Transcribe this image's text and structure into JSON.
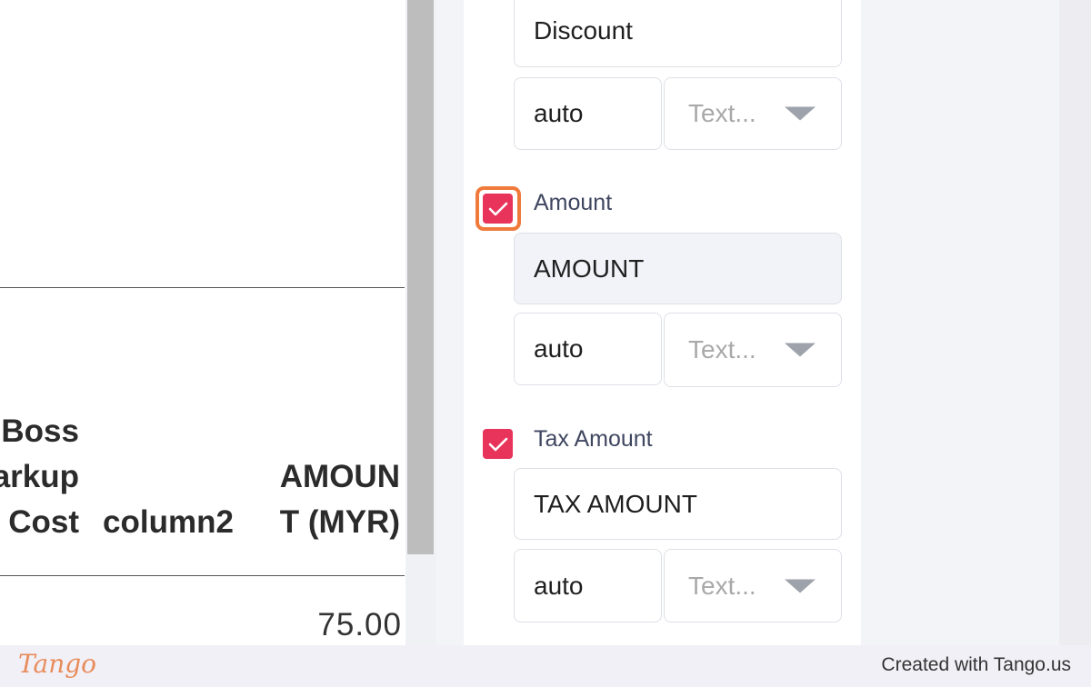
{
  "table": {
    "header_boss_markup_cost": "Boss\narkup\n Cost",
    "header_column2": "column2",
    "header_amount": "AMOUN\nT (MYR)",
    "row_amount_value": "75.00"
  },
  "panel": {
    "discount": {
      "name_value": "Discount",
      "width_value": "auto",
      "type_placeholder": "Text..."
    },
    "amount": {
      "label": "Amount",
      "checked": true,
      "name_value": "AMOUNT",
      "width_value": "auto",
      "type_placeholder": "Text..."
    },
    "tax_amount": {
      "label": "Tax Amount",
      "checked": true,
      "name_value": "TAX AMOUNT",
      "width_value": "auto",
      "type_placeholder": "Text..."
    }
  },
  "footer": {
    "logo": "Tango",
    "credit": "Created with Tango.us"
  },
  "colors": {
    "checkbox": "#e8345b",
    "highlight": "#f07a3b",
    "label": "#3f4660"
  },
  "icons": [
    "check-icon",
    "chevron-down-icon"
  ]
}
